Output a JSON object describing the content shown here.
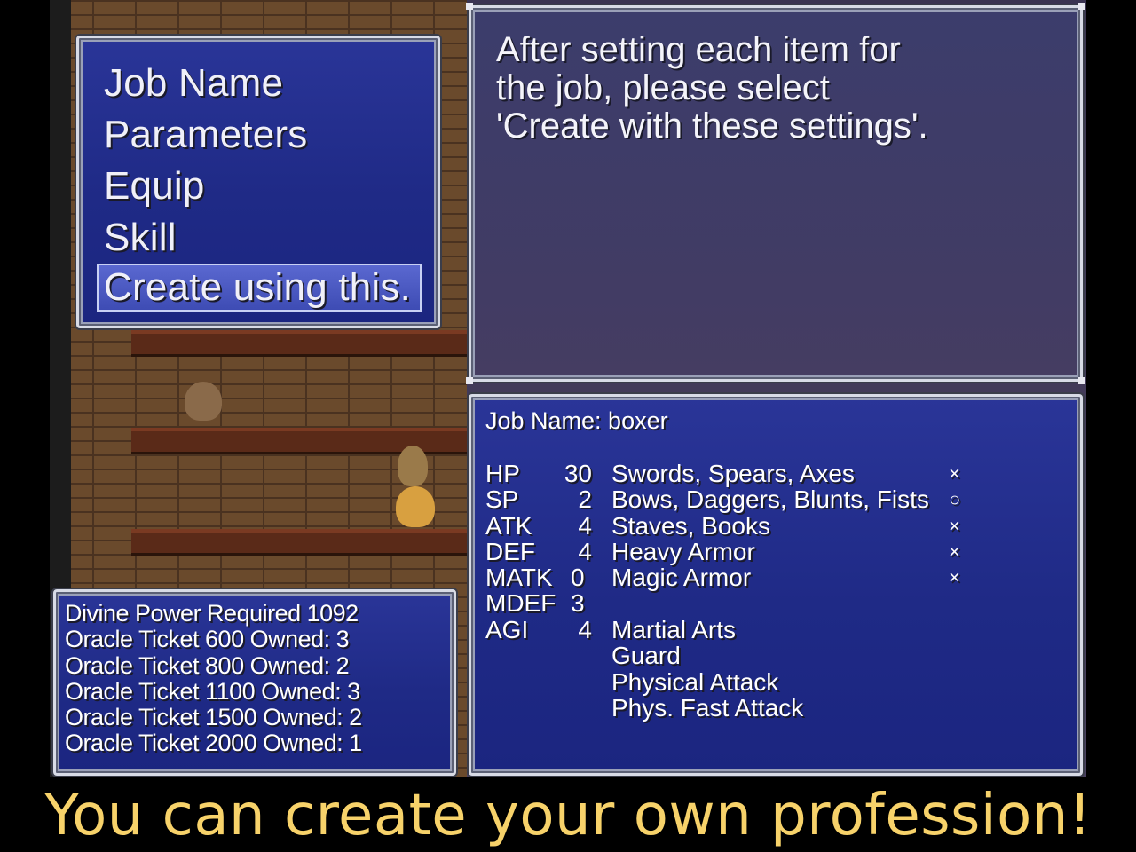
{
  "command_menu": {
    "items": [
      "Job Name",
      "Parameters",
      "Equip",
      "Skill",
      "Create using this."
    ],
    "selected_index": 4
  },
  "help": {
    "lines": [
      "After setting each item for",
      "the job, please select",
      "'Create with these settings'."
    ]
  },
  "cost": {
    "rows": [
      "Divine Power Required 1092",
      "Oracle Ticket 600 Owned: 3",
      "Oracle Ticket 800 Owned: 2",
      "Oracle Ticket 1100 Owned: 3",
      "Oracle Ticket 1500 Owned: 2",
      "Oracle Ticket 2000 Owned: 1"
    ]
  },
  "status": {
    "job_name": "Job Name: boxer",
    "stats": [
      {
        "key": "HP",
        "value": "30"
      },
      {
        "key": "SP",
        "value": "2"
      },
      {
        "key": "ATK",
        "value": "4"
      },
      {
        "key": "DEF",
        "value": "4"
      },
      {
        "key": "MATK",
        "value": "0"
      },
      {
        "key": "MDEF",
        "value": "3"
      },
      {
        "key": "AGI",
        "value": "4"
      }
    ],
    "equipment": [
      {
        "label": "Swords, Spears, Axes",
        "mark": "×"
      },
      {
        "label": "Bows, Daggers, Blunts, Fists",
        "mark": "○"
      },
      {
        "label": "Staves, Books",
        "mark": "×"
      },
      {
        "label": "Heavy Armor",
        "mark": "×"
      },
      {
        "label": "Magic Armor",
        "mark": "×"
      }
    ],
    "skills": [
      "Martial Arts",
      "Guard",
      "Physical Attack",
      "Phys. Fast Attack"
    ]
  },
  "caption": "You can create your own profession!",
  "colors": {
    "window_blue": "#1f2a86",
    "window_border": "#d8dbe6",
    "selection": "#4a58c0",
    "caption_yellow": "#f7d26a"
  }
}
